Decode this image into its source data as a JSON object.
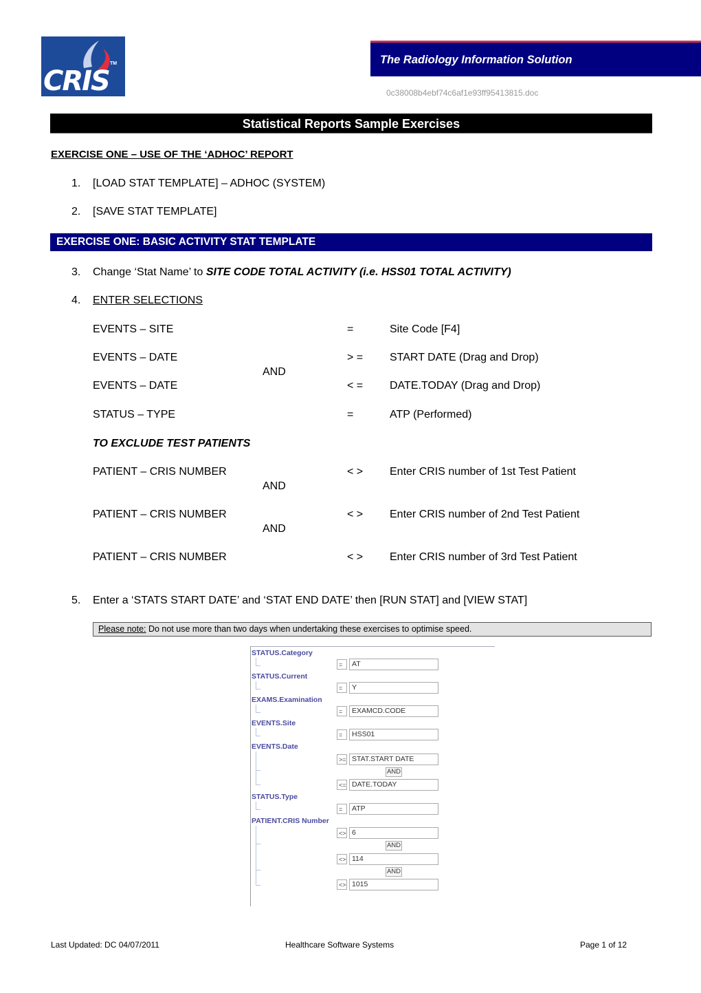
{
  "header": {
    "logo_text": "CRIS",
    "logo_tm": "TM",
    "banner_title": "The Radiology Information Solution",
    "document_name": "0c38008b4ebf74c6af1e93ff95413815.doc",
    "colors": {
      "banner": "#000080",
      "banner_accent": "#d03050",
      "logo_bg": "#1e4a9a"
    }
  },
  "title": "Statistical Reports Sample Exercises",
  "exercise_heading": "EXERCISE ONE – USE OF THE ‘ADHOC’ REPORT",
  "steps_top": [
    {
      "num": "1.",
      "text": "[LOAD STAT TEMPLATE] – ADHOC (SYSTEM)"
    },
    {
      "num": "2.",
      "text": "[SAVE STAT TEMPLATE]"
    }
  ],
  "section_bar": "EXERCISE ONE: BASIC ACTIVITY STAT TEMPLATE",
  "step3": {
    "num": "3.",
    "prefix": "Change ‘Stat Name’ to ",
    "emph": "SITE CODE TOTAL ACTIVITY (i.e. HSS01 TOTAL ACTIVITY)"
  },
  "step4": {
    "num": "4.",
    "text": "ENTER SELECTIONS"
  },
  "selections": [
    {
      "field": "EVENTS – SITE",
      "op": "=",
      "value": "Site Code [F4]"
    },
    {
      "field": "EVENTS – DATE",
      "op": "> =",
      "value": "START DATE (Drag and Drop)"
    },
    {
      "field": "EVENTS – DATE",
      "op": "< =",
      "value": "DATE.TODAY (Drag and Drop)"
    },
    {
      "field": "STATUS – TYPE",
      "op": "=",
      "value": "ATP (Performed)"
    }
  ],
  "and_label": "AND",
  "exclude_heading": "TO EXCLUDE TEST PATIENTS",
  "exclusions": [
    {
      "field": "PATIENT – CRIS NUMBER",
      "op": "< >",
      "value": "Enter CRIS number of 1st Test Patient"
    },
    {
      "field": "PATIENT – CRIS NUMBER",
      "op": "< >",
      "value": "Enter CRIS number of 2nd Test Patient"
    },
    {
      "field": "PATIENT – CRIS NUMBER",
      "op": "< >",
      "value": "Enter CRIS number of 3rd Test Patient"
    }
  ],
  "step5": {
    "num": "5.",
    "text": "Enter a ‘STATS START DATE’ and ‘STAT END DATE’ then [RUN STAT] and [VIEW STAT]"
  },
  "note": {
    "label": "Please note:",
    "text": " Do not use more than two days when undertaking these exercises to optimise speed."
  },
  "panel": {
    "fields": [
      {
        "label": "STATUS.Category",
        "rows": [
          {
            "op": "=",
            "value": "AT"
          }
        ]
      },
      {
        "label": "STATUS.Current",
        "rows": [
          {
            "op": "=",
            "value": "Y"
          }
        ]
      },
      {
        "label": "EXAMS.Examination",
        "rows": [
          {
            "op": "=",
            "value": "EXAMCD.CODE"
          }
        ]
      },
      {
        "label": "EVENTS.Site",
        "rows": [
          {
            "op": "=",
            "value": "HSS01"
          }
        ]
      },
      {
        "label": "EVENTS.Date",
        "rows": [
          {
            "op": ">=",
            "value": "STAT.START DATE"
          },
          {
            "op": "<=",
            "value": "DATE.TODAY"
          }
        ]
      },
      {
        "label": "STATUS.Type",
        "rows": [
          {
            "op": "=",
            "value": "ATP"
          }
        ]
      },
      {
        "label": "PATIENT.CRIS Number",
        "rows": [
          {
            "op": "<>",
            "value": "6"
          },
          {
            "op": "<>",
            "value": "114"
          },
          {
            "op": "<>",
            "value": "1015"
          }
        ]
      }
    ],
    "and_button": "AND"
  },
  "footer": {
    "left": "Last Updated: DC 04/07/2011",
    "center": "Healthcare Software Systems",
    "right": "Page 1 of 12"
  }
}
